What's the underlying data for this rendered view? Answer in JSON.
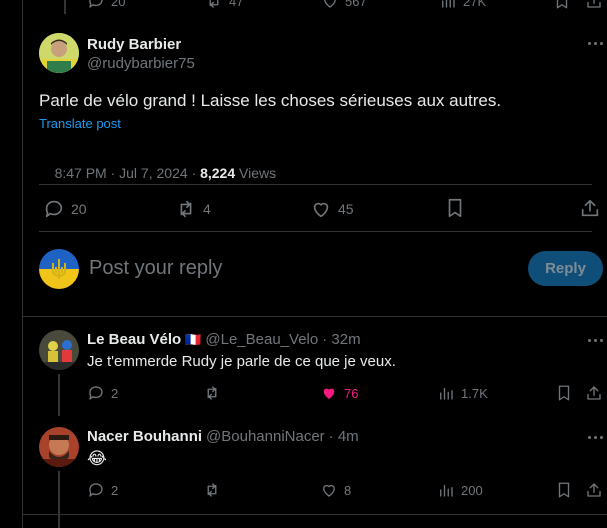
{
  "prev_tweet_metrics": {
    "replies": "20",
    "reposts": "47",
    "likes": "567",
    "views": "27K"
  },
  "main_tweet": {
    "name": "Rudy Barbier",
    "handle": "@rudybarbier75",
    "text": "Parle de vélo grand ! Laisse les choses sérieuses aux autres.",
    "translate": "Translate post",
    "time": "8:47 PM · Jul 7, 2024 · ",
    "views_count": "8,224",
    "views_label": "Views",
    "replies": "20",
    "reposts": "4",
    "likes": "45"
  },
  "reply_box": {
    "placeholder": "Post your reply",
    "button": "Reply"
  },
  "replies": [
    {
      "name": "Le Beau Vélo",
      "flag": "🇫🇷",
      "handle": "@Le_Beau_Velo",
      "time": "· 32m",
      "text": "Je t'emmerde Rudy je parle de ce que je veux.",
      "replies": "2",
      "reposts": "",
      "likes": "76",
      "views": "1.7K",
      "liked": true
    },
    {
      "name": "Nacer Bouhanni",
      "handle": "@BouhanniNacer",
      "time": "· 4m",
      "text": "😂",
      "replies": "2",
      "reposts": "",
      "likes": "8",
      "views": "200",
      "liked": false
    }
  ],
  "colors": {
    "accent": "#1d9bf0",
    "like": "#f91880",
    "button_bg": "#0f4e78"
  }
}
